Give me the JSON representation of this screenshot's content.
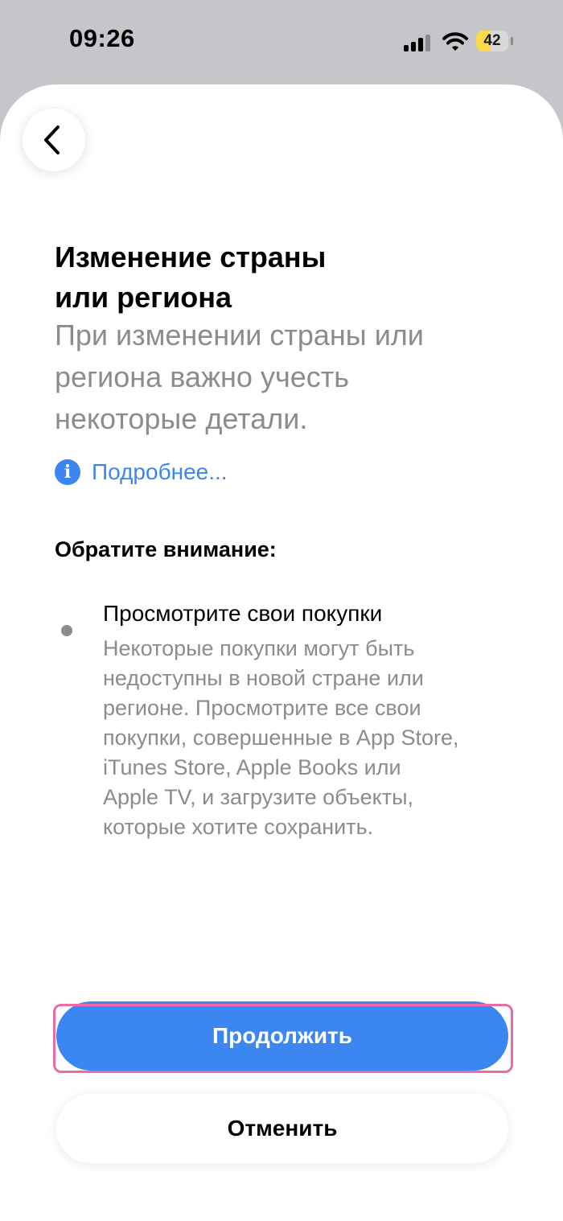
{
  "status_bar": {
    "time": "09:26",
    "battery": "42"
  },
  "sheet": {
    "title_lines": [
      "Изменение страны",
      "или региона"
    ],
    "subtitle_lines": [
      "При изменении страны или",
      "региона важно учесть",
      "некоторые детали."
    ],
    "more_link": "Подробнее...",
    "note_heading": "Обратите внимание:",
    "bullet": {
      "title": "Просмотрите свои покупки",
      "body_lines": [
        "Некоторые покупки могут быть",
        "недоступны в новой стране или",
        "регионе. Просмотрите все свои",
        "покупки, совершенные в App Store,",
        "iTunes Store, Apple Books или",
        "Apple TV, и загрузите объекты,",
        "которые хотите сохранить."
      ]
    },
    "continue_label": "Продолжить",
    "cancel_label": "Отменить"
  },
  "colors": {
    "accent": "#3b86f0",
    "secondary_text": "#8b8b90",
    "highlight": "#ec6aa6",
    "battery": "#fada4a"
  },
  "icons": {
    "back": "chevron-left-icon",
    "info": "info-circle-icon",
    "signal": "cellular-signal-icon",
    "wifi": "wifi-icon"
  }
}
